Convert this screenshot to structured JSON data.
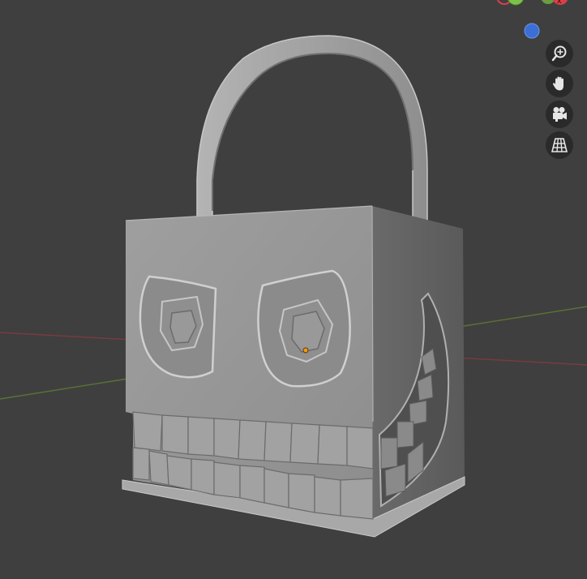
{
  "viewport": {
    "background": "#3f3f3f",
    "model": "padlock-face-sculpt",
    "model_color": "#9a9a9a",
    "x_axis_color": "#b04a54",
    "y_axis_color": "#6a8a3c"
  },
  "gizmo": {
    "axes": [
      {
        "name": "x-axis",
        "color": "#d6404a"
      },
      {
        "name": "y-axis",
        "color": "#7cc24a"
      },
      {
        "name": "z-axis",
        "color": "#3b6fd6"
      }
    ]
  },
  "navigation": {
    "buttons": [
      {
        "name": "zoom-button",
        "icon": "magnifier-plus-icon"
      },
      {
        "name": "pan-button",
        "icon": "hand-icon"
      },
      {
        "name": "camera-view-button",
        "icon": "camera-icon"
      },
      {
        "name": "perspective-toggle-button",
        "icon": "grid-icon"
      }
    ]
  }
}
